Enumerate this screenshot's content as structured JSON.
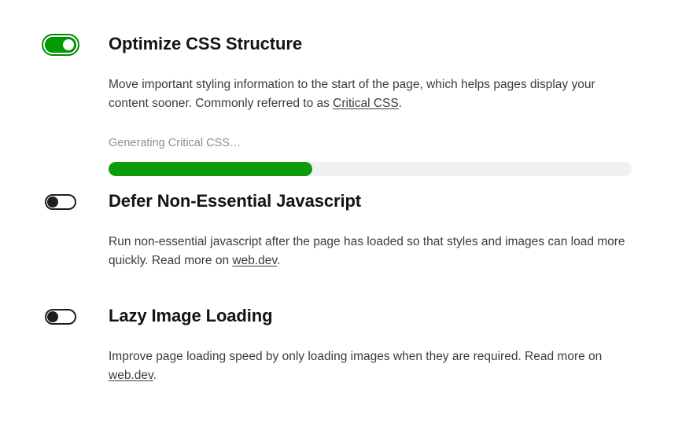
{
  "page": {
    "background_color": "#ffffff",
    "text_color": "#3c3c3c",
    "heading_color": "#141414",
    "accent_color": "#0b9b0b",
    "muted_color": "#8e8e8e"
  },
  "settings": [
    {
      "id": "optimize-css-structure",
      "title": "Optimize CSS Structure",
      "toggle": {
        "name": "optimize-css-structure-toggle",
        "state": "on",
        "state_label": "On"
      },
      "description_before_link": "Move important styling information to the start of the page, which helps pages display your content sooner. Commonly referred to as ",
      "link_label": "Critical CSS",
      "description_after_link": ".",
      "progress": {
        "status_text": "Generating Critical CSS…",
        "percent": 39,
        "percent_label": "39%",
        "fill_color": "#0b9b0b",
        "track_color": "#f0f0f0"
      }
    },
    {
      "id": "defer-non-essential-javascript",
      "title": "Defer Non-Essential Javascript",
      "toggle": {
        "name": "defer-non-essential-javascript-toggle",
        "state": "off",
        "state_label": "Off"
      },
      "description_before_link": "Run non-essential javascript after the page has loaded so that styles and images can load more quickly. Read more on ",
      "link_label": "web.dev",
      "description_after_link": "."
    },
    {
      "id": "lazy-image-loading",
      "title": "Lazy Image Loading",
      "toggle": {
        "name": "lazy-image-loading-toggle",
        "state": "off",
        "state_label": "Off"
      },
      "description_before_link": "Improve page loading speed by only loading images when they are required. Read more on ",
      "link_label": "web.dev",
      "description_after_link": "."
    }
  ]
}
